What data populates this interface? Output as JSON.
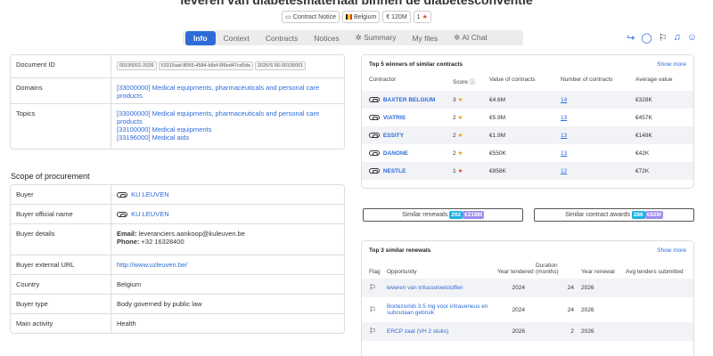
{
  "header": {
    "title": "leveren van diabetesmateriaal binnen de diabetesconventie",
    "chips": {
      "notice": "Contract Notice",
      "country": "Belgium",
      "value": "€ 120M",
      "rating": "1"
    }
  },
  "tabs": [
    "Info",
    "Context",
    "Contracts",
    "Notices",
    "Summary",
    "My files",
    "AI Chat"
  ],
  "document": {
    "id_label": "Document ID",
    "ids": [
      "00195001-2026",
      "53315aaf-8055-4584-b8ef-6f6ed47cd0da",
      "2026/S 56-00195001"
    ],
    "domains_label": "Domains",
    "domains": "[33000000] Medical equipments, pharmaceuticals and personal care products",
    "topics_label": "Topics",
    "topics": [
      "[33000000] Medical equipments, pharmaceuticals and personal care products",
      "[33100000] Medical equipments",
      "[33196000] Medical aids"
    ]
  },
  "scope_title": "Scope of procurement",
  "buyer": {
    "buyer_label": "Buyer",
    "buyer": "KU LEUVEN",
    "official_label": "Buyer official name",
    "official": "KU LEUVEN",
    "details_label": "Buyer details",
    "email_label": "Email:",
    "email": "leveranciers.aankoop@kuleuven.be",
    "phone_label": "Phone:",
    "phone": "+32 16328400",
    "url_label": "Buyer external URL",
    "url": "http://www.uzleuven.be/",
    "country_label": "Country",
    "country": "Belgium",
    "type_label": "Buyer type",
    "type": "Body governed by public law",
    "activity_label": "Main activity",
    "activity": "Health"
  },
  "winners": {
    "title": "Top 5 winners of similar contracts",
    "more": "Show more",
    "headers": [
      "Contractor",
      "Score",
      "Value of contracts",
      "Number of contracts",
      "Average value"
    ],
    "rows": [
      {
        "name": "BAXTER BELGIUM",
        "score": "3",
        "value": "€4.6M",
        "count": "14",
        "avg": "€328K"
      },
      {
        "name": "VIATRIS",
        "score": "2",
        "value": "€5.9M",
        "count": "13",
        "avg": "€457K"
      },
      {
        "name": "ESSITY",
        "score": "2",
        "value": "€1.9M",
        "count": "13",
        "avg": "€148K"
      },
      {
        "name": "DANONE",
        "score": "2",
        "value": "€550K",
        "count": "13",
        "avg": "€42K"
      },
      {
        "name": "NESTLE",
        "score": "1",
        "value": "€858K",
        "count": "12",
        "avg": "€72K"
      }
    ]
  },
  "similar": {
    "renewals_label": "Similar renewals",
    "renewals_count": "202",
    "renewals_value": "€218M",
    "awards_label": "Similar contract awards",
    "awards_count": "286",
    "awards_value": "€82M"
  },
  "renewals": {
    "title": "Top 3 similar renewals",
    "more": "Show more",
    "headers": [
      "Flag",
      "Opportunity",
      "Year tendered",
      "Duration (months)",
      "Year renewal",
      "Avg tenders submitted"
    ],
    "rows": [
      {
        "opp": "leveren van infuusvloeistoffen",
        "year": "2024",
        "dur": "24",
        "renew": "2026"
      },
      {
        "opp": "Bortezomib 3.5 mg voor intraveneus en subcutaan gebruik",
        "year": "2024",
        "dur": "24",
        "renew": "2026"
      },
      {
        "opp": "ERCP zaal (VH 2 stuks)",
        "year": "2026",
        "dur": "2",
        "renew": "2026"
      }
    ]
  }
}
